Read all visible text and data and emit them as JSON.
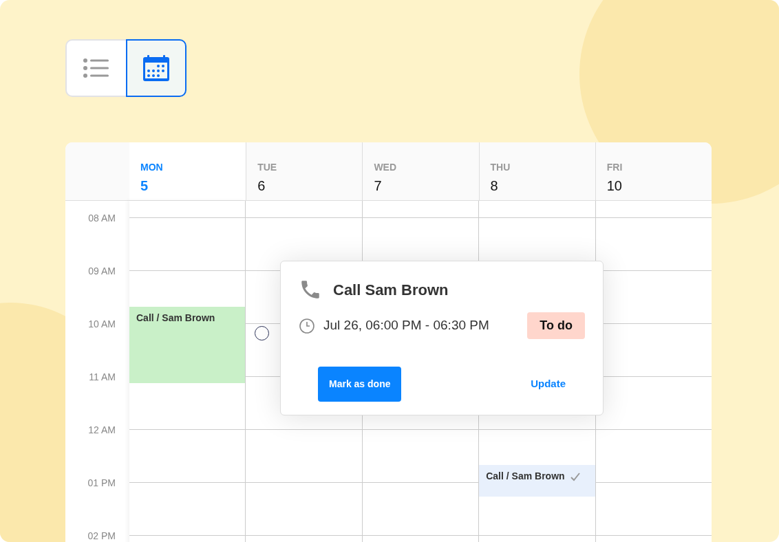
{
  "view_toggle": [
    {
      "kind": "list",
      "selected": false
    },
    {
      "kind": "calendar",
      "selected": true
    }
  ],
  "days": [
    {
      "name": "MON",
      "date": "5",
      "selected": true,
      "events": [
        {
          "title": "Call / Sam Brown",
          "done": false
        }
      ]
    },
    {
      "name": "TUE",
      "date": "6",
      "selected": false
    },
    {
      "name": "WED",
      "date": "7",
      "selected": false
    },
    {
      "name": "THU",
      "date": "8",
      "selected": false,
      "events": [
        {
          "title": "Call / Sam Brown",
          "done": true
        }
      ]
    },
    {
      "name": "FRI",
      "date": "10",
      "selected": false
    }
  ],
  "hours": [
    "08 AM",
    "09 AM",
    "10 AM",
    "11 AM",
    "12 AM",
    "01 PM",
    "02 PM"
  ],
  "popover": {
    "title": "Call Sam Brown",
    "time": "Jul 26, 06:00 PM - 06:30 PM",
    "status": "To do",
    "primary_button": "Mark as done",
    "secondary_button": "Update"
  }
}
